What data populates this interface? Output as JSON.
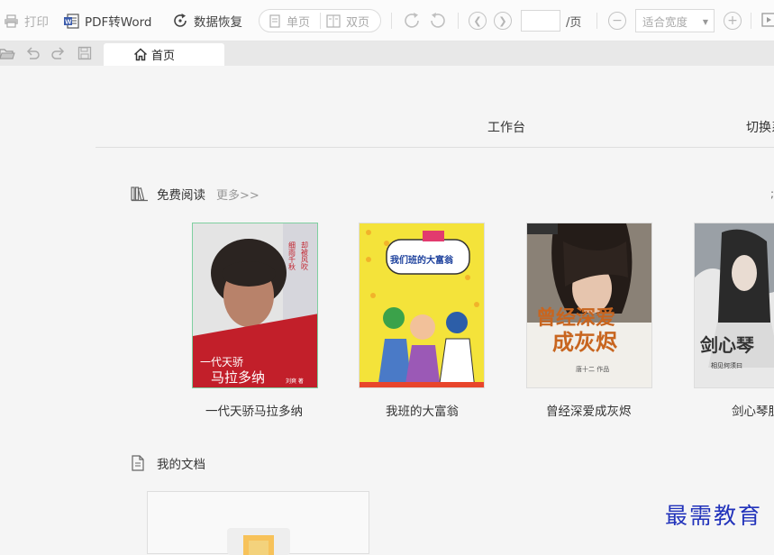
{
  "toolbar": {
    "print": "打印",
    "pdf_to_word": "PDF转Word",
    "data_recovery": "数据恢复",
    "single_page": "单页",
    "double_page": "双页",
    "page_input_value": "",
    "page_suffix": "/页",
    "zoom_value": "适合宽度"
  },
  "tabs": [
    {
      "label": "首页",
      "icon": "home-icon",
      "active": true
    }
  ],
  "quick_access": [
    "open-folder-icon",
    "undo-icon",
    "redo-icon",
    "save-icon"
  ],
  "nav": {
    "workbench": "工作台",
    "switch": "切换系"
  },
  "free_reading": {
    "title": "免费阅读",
    "more": "更多>>",
    "books": [
      {
        "title": "一代天骄马拉多纳",
        "cover_title": "一代天骄",
        "cover_subtitle": "马拉多纳",
        "cover_author": "刘爽 著"
      },
      {
        "title": "我班的大富翁",
        "cover_title": "我们班的大富翁"
      },
      {
        "title": "曾经深爱成灰烬",
        "cover_title": "曾经深爱",
        "cover_subtitle": "成灰烬",
        "cover_author": "唐十二 作品"
      },
      {
        "title": "剑心琴胆",
        "cover_title": "剑心琴",
        "cover_author": "相见何须曰"
      }
    ]
  },
  "my_docs": {
    "title": "我的文档"
  },
  "watermark": "最需教育",
  "colors": {
    "accent_green": "#7fcfa0",
    "watermark_blue": "#2233bb"
  }
}
